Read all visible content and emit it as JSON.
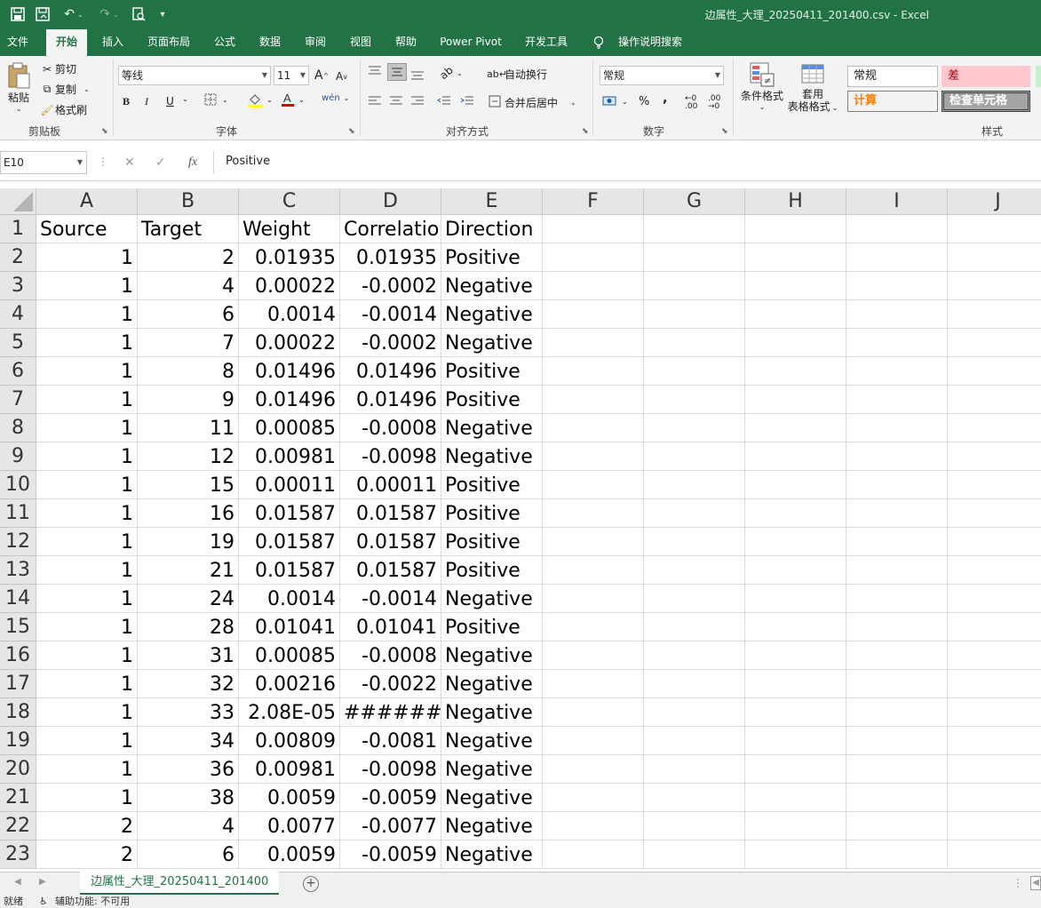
{
  "window": {
    "title": "边属性_大理_20250411_201400.csv  -  Excel"
  },
  "quick_access": [
    "save-icon",
    "autosave-icon",
    "undo-icon",
    "redo-icon",
    "print-preview-icon",
    "customize-icon"
  ],
  "ribbon_tabs": [
    "文件",
    "开始",
    "插入",
    "页面布局",
    "公式",
    "数据",
    "审阅",
    "视图",
    "帮助",
    "Power Pivot",
    "开发工具",
    "操作说明搜索"
  ],
  "active_tab": "开始",
  "clipboard": {
    "paste": "粘贴",
    "cut": "剪切",
    "copy": "复制",
    "format_painter": "格式刷",
    "group": "剪贴板"
  },
  "font": {
    "name": "等线",
    "size": "11",
    "group": "字体",
    "bold": "B",
    "italic": "I",
    "underline": "U"
  },
  "alignment": {
    "wrap": "自动换行",
    "merge": "合并后居中",
    "group": "对齐方式"
  },
  "number": {
    "format": "常规",
    "percent": "%",
    "comma": ",",
    "group": "数字"
  },
  "styles": {
    "conditional": "条件格式",
    "table_l1": "套用",
    "table_l2": "表格格式",
    "normal": "常规",
    "bad": "差",
    "calc": "计算",
    "check": "检查单元格",
    "group": "样式"
  },
  "formula_bar": {
    "name_box": "E10",
    "content": "Positive",
    "fx": "fx"
  },
  "columns": [
    "A",
    "B",
    "C",
    "D",
    "E",
    "F",
    "G",
    "H",
    "I",
    "J"
  ],
  "rows": [
    [
      "Source",
      "Target",
      "Weight",
      "Correlatio",
      "Direction"
    ],
    [
      "1",
      "2",
      "0.01935",
      "0.01935",
      "Positive"
    ],
    [
      "1",
      "4",
      "0.00022",
      "-0.0002",
      "Negative"
    ],
    [
      "1",
      "6",
      "0.0014",
      "-0.0014",
      "Negative"
    ],
    [
      "1",
      "7",
      "0.00022",
      "-0.0002",
      "Negative"
    ],
    [
      "1",
      "8",
      "0.01496",
      "0.01496",
      "Positive"
    ],
    [
      "1",
      "9",
      "0.01496",
      "0.01496",
      "Positive"
    ],
    [
      "1",
      "11",
      "0.00085",
      "-0.0008",
      "Negative"
    ],
    [
      "1",
      "12",
      "0.00981",
      "-0.0098",
      "Negative"
    ],
    [
      "1",
      "15",
      "0.00011",
      "0.00011",
      "Positive"
    ],
    [
      "1",
      "16",
      "0.01587",
      "0.01587",
      "Positive"
    ],
    [
      "1",
      "19",
      "0.01587",
      "0.01587",
      "Positive"
    ],
    [
      "1",
      "21",
      "0.01587",
      "0.01587",
      "Positive"
    ],
    [
      "1",
      "24",
      "0.0014",
      "-0.0014",
      "Negative"
    ],
    [
      "1",
      "28",
      "0.01041",
      "0.01041",
      "Positive"
    ],
    [
      "1",
      "31",
      "0.00085",
      "-0.0008",
      "Negative"
    ],
    [
      "1",
      "32",
      "0.00216",
      "-0.0022",
      "Negative"
    ],
    [
      "1",
      "33",
      "2.08E-05",
      "######",
      "Negative"
    ],
    [
      "1",
      "34",
      "0.00809",
      "-0.0081",
      "Negative"
    ],
    [
      "1",
      "36",
      "0.00981",
      "-0.0098",
      "Negative"
    ],
    [
      "1",
      "38",
      "0.0059",
      "-0.0059",
      "Negative"
    ],
    [
      "2",
      "4",
      "0.0077",
      "-0.0077",
      "Negative"
    ],
    [
      "2",
      "6",
      "0.0059",
      "-0.0059",
      "Negative"
    ]
  ],
  "sheet_tab": "边属性_大理_20250411_201400",
  "status": {
    "ready": "就绪",
    "accessibility": "辅助功能: 不可用"
  }
}
